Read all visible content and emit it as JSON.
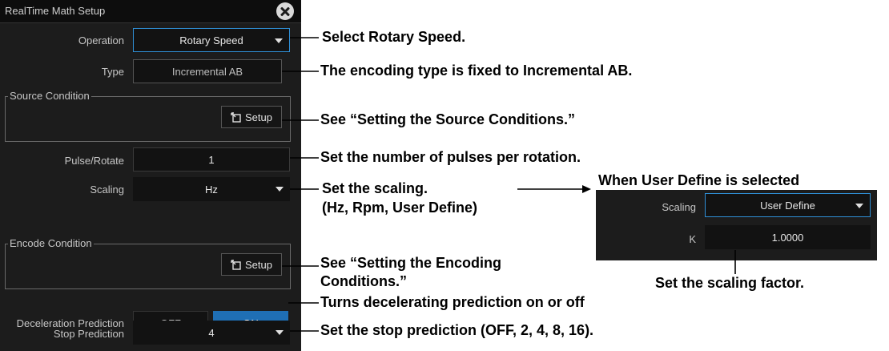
{
  "dialog": {
    "title": "RealTime Math Setup",
    "fields": {
      "operation": {
        "label": "Operation",
        "value": "Rotary Speed"
      },
      "type": {
        "label": "Type",
        "value": "Incremental AB"
      },
      "pulse_rotate": {
        "label": "Pulse/Rotate",
        "value": "1"
      },
      "scaling": {
        "label": "Scaling",
        "value": "Hz"
      },
      "deceleration_prediction": {
        "label": "Deceleration Prediction",
        "off_label": "OFF",
        "on_label": "ON",
        "selected": "ON"
      },
      "stop_prediction": {
        "label": "Stop Prediction",
        "value": "4"
      }
    },
    "source_condition": {
      "title": "Source Condition",
      "button_label": "Setup"
    },
    "encode_condition": {
      "title": "Encode Condition",
      "button_label": "Setup"
    }
  },
  "annotations": {
    "operation": "Select Rotary Speed.",
    "type": "The encoding type is fixed to Incremental AB.",
    "source_condition": "See “Setting the Source Conditions.”",
    "pulse_rotate": "Set the number of pulses per rotation.",
    "scaling_line1": "Set the scaling.",
    "scaling_line2": "(Hz, Rpm, User Define)",
    "user_define_heading": "When User Define is selected",
    "encode_condition_line1": "See “Setting the Encoding",
    "encode_condition_line2": "Conditions.”",
    "scaling_factor": "Set the scaling factor.",
    "deceleration": "Turns decelerating prediction on or off",
    "stop_prediction": "Set the stop prediction (OFF, 2, 4, 8, 16)."
  },
  "inset": {
    "scaling_label": "Scaling",
    "scaling_value": "User Define",
    "k_label": "K",
    "k_value": "1.0000"
  },
  "colors": {
    "panel_bg": "#1c1c1c",
    "field_bg": "#121212",
    "accent_blue": "#1f6fb5",
    "focus_border": "#2f8fd6"
  }
}
